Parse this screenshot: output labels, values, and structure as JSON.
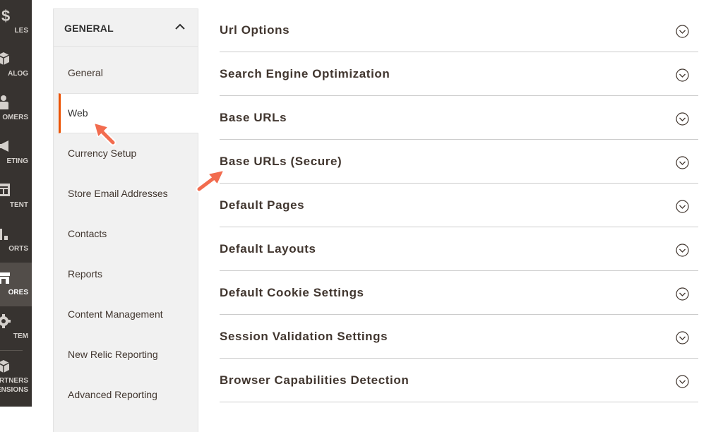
{
  "admin_menu": {
    "items": [
      {
        "label": "LES",
        "icon": "dollar-icon"
      },
      {
        "label": "ALOG",
        "icon": "box-icon"
      },
      {
        "label": "OMERS",
        "icon": "person-icon"
      },
      {
        "label": "ETING",
        "icon": "megaphone-icon"
      },
      {
        "label": "TENT",
        "icon": "layout-icon"
      },
      {
        "label": "ORTS",
        "icon": "bar-chart-icon"
      },
      {
        "label": "ORES",
        "icon": "store-icon",
        "active": true
      },
      {
        "label": "TEM",
        "icon": "gear-icon"
      }
    ],
    "partners_line1": "ARTNERS",
    "partners_line2": "ENSIONS"
  },
  "config_tabs": {
    "header": "GENERAL",
    "items": [
      {
        "label": "General"
      },
      {
        "label": "Web",
        "active": true
      },
      {
        "label": "Currency Setup"
      },
      {
        "label": "Store Email Addresses"
      },
      {
        "label": "Contacts"
      },
      {
        "label": "Reports"
      },
      {
        "label": "Content Management"
      },
      {
        "label": "New Relic Reporting"
      },
      {
        "label": "Advanced Reporting"
      }
    ]
  },
  "sections": [
    {
      "title": "Url Options"
    },
    {
      "title": "Search Engine Optimization"
    },
    {
      "title": "Base URLs"
    },
    {
      "title": "Base URLs (Secure)"
    },
    {
      "title": "Default Pages"
    },
    {
      "title": "Default Layouts"
    },
    {
      "title": "Default Cookie Settings"
    },
    {
      "title": "Session Validation Settings"
    },
    {
      "title": "Browser Capabilities Detection"
    }
  ],
  "colors": {
    "nav_bg": "#373330",
    "nav_active_bg": "#524d49",
    "accent": "#eb5202",
    "annotation_arrow": "#f26c4f"
  }
}
